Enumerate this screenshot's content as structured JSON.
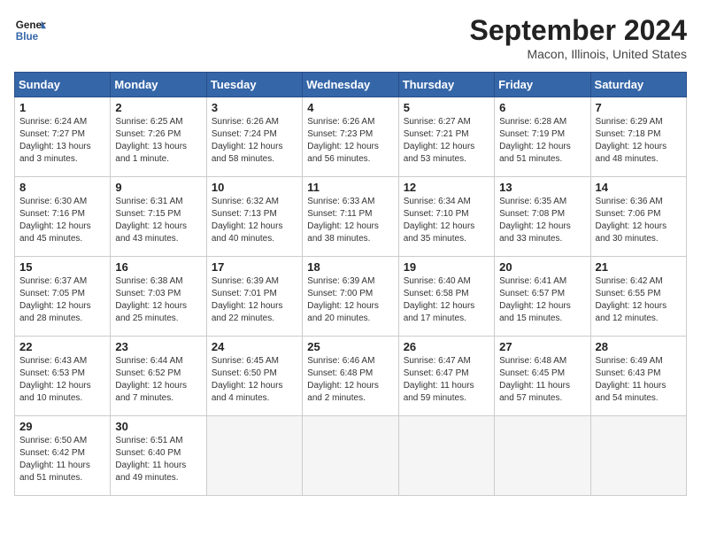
{
  "header": {
    "logo_line1": "General",
    "logo_line2": "Blue",
    "month": "September 2024",
    "location": "Macon, Illinois, United States"
  },
  "weekdays": [
    "Sunday",
    "Monday",
    "Tuesday",
    "Wednesday",
    "Thursday",
    "Friday",
    "Saturday"
  ],
  "weeks": [
    [
      {
        "day": "1",
        "sunrise": "6:24 AM",
        "sunset": "7:27 PM",
        "daylight": "13 hours and 3 minutes."
      },
      {
        "day": "2",
        "sunrise": "6:25 AM",
        "sunset": "7:26 PM",
        "daylight": "13 hours and 1 minute."
      },
      {
        "day": "3",
        "sunrise": "6:26 AM",
        "sunset": "7:24 PM",
        "daylight": "12 hours and 58 minutes."
      },
      {
        "day": "4",
        "sunrise": "6:26 AM",
        "sunset": "7:23 PM",
        "daylight": "12 hours and 56 minutes."
      },
      {
        "day": "5",
        "sunrise": "6:27 AM",
        "sunset": "7:21 PM",
        "daylight": "12 hours and 53 minutes."
      },
      {
        "day": "6",
        "sunrise": "6:28 AM",
        "sunset": "7:19 PM",
        "daylight": "12 hours and 51 minutes."
      },
      {
        "day": "7",
        "sunrise": "6:29 AM",
        "sunset": "7:18 PM",
        "daylight": "12 hours and 48 minutes."
      }
    ],
    [
      {
        "day": "8",
        "sunrise": "6:30 AM",
        "sunset": "7:16 PM",
        "daylight": "12 hours and 45 minutes."
      },
      {
        "day": "9",
        "sunrise": "6:31 AM",
        "sunset": "7:15 PM",
        "daylight": "12 hours and 43 minutes."
      },
      {
        "day": "10",
        "sunrise": "6:32 AM",
        "sunset": "7:13 PM",
        "daylight": "12 hours and 40 minutes."
      },
      {
        "day": "11",
        "sunrise": "6:33 AM",
        "sunset": "7:11 PM",
        "daylight": "12 hours and 38 minutes."
      },
      {
        "day": "12",
        "sunrise": "6:34 AM",
        "sunset": "7:10 PM",
        "daylight": "12 hours and 35 minutes."
      },
      {
        "day": "13",
        "sunrise": "6:35 AM",
        "sunset": "7:08 PM",
        "daylight": "12 hours and 33 minutes."
      },
      {
        "day": "14",
        "sunrise": "6:36 AM",
        "sunset": "7:06 PM",
        "daylight": "12 hours and 30 minutes."
      }
    ],
    [
      {
        "day": "15",
        "sunrise": "6:37 AM",
        "sunset": "7:05 PM",
        "daylight": "12 hours and 28 minutes."
      },
      {
        "day": "16",
        "sunrise": "6:38 AM",
        "sunset": "7:03 PM",
        "daylight": "12 hours and 25 minutes."
      },
      {
        "day": "17",
        "sunrise": "6:39 AM",
        "sunset": "7:01 PM",
        "daylight": "12 hours and 22 minutes."
      },
      {
        "day": "18",
        "sunrise": "6:39 AM",
        "sunset": "7:00 PM",
        "daylight": "12 hours and 20 minutes."
      },
      {
        "day": "19",
        "sunrise": "6:40 AM",
        "sunset": "6:58 PM",
        "daylight": "12 hours and 17 minutes."
      },
      {
        "day": "20",
        "sunrise": "6:41 AM",
        "sunset": "6:57 PM",
        "daylight": "12 hours and 15 minutes."
      },
      {
        "day": "21",
        "sunrise": "6:42 AM",
        "sunset": "6:55 PM",
        "daylight": "12 hours and 12 minutes."
      }
    ],
    [
      {
        "day": "22",
        "sunrise": "6:43 AM",
        "sunset": "6:53 PM",
        "daylight": "12 hours and 10 minutes."
      },
      {
        "day": "23",
        "sunrise": "6:44 AM",
        "sunset": "6:52 PM",
        "daylight": "12 hours and 7 minutes."
      },
      {
        "day": "24",
        "sunrise": "6:45 AM",
        "sunset": "6:50 PM",
        "daylight": "12 hours and 4 minutes."
      },
      {
        "day": "25",
        "sunrise": "6:46 AM",
        "sunset": "6:48 PM",
        "daylight": "12 hours and 2 minutes."
      },
      {
        "day": "26",
        "sunrise": "6:47 AM",
        "sunset": "6:47 PM",
        "daylight": "11 hours and 59 minutes."
      },
      {
        "day": "27",
        "sunrise": "6:48 AM",
        "sunset": "6:45 PM",
        "daylight": "11 hours and 57 minutes."
      },
      {
        "day": "28",
        "sunrise": "6:49 AM",
        "sunset": "6:43 PM",
        "daylight": "11 hours and 54 minutes."
      }
    ],
    [
      {
        "day": "29",
        "sunrise": "6:50 AM",
        "sunset": "6:42 PM",
        "daylight": "11 hours and 51 minutes."
      },
      {
        "day": "30",
        "sunrise": "6:51 AM",
        "sunset": "6:40 PM",
        "daylight": "11 hours and 49 minutes."
      },
      null,
      null,
      null,
      null,
      null
    ]
  ]
}
